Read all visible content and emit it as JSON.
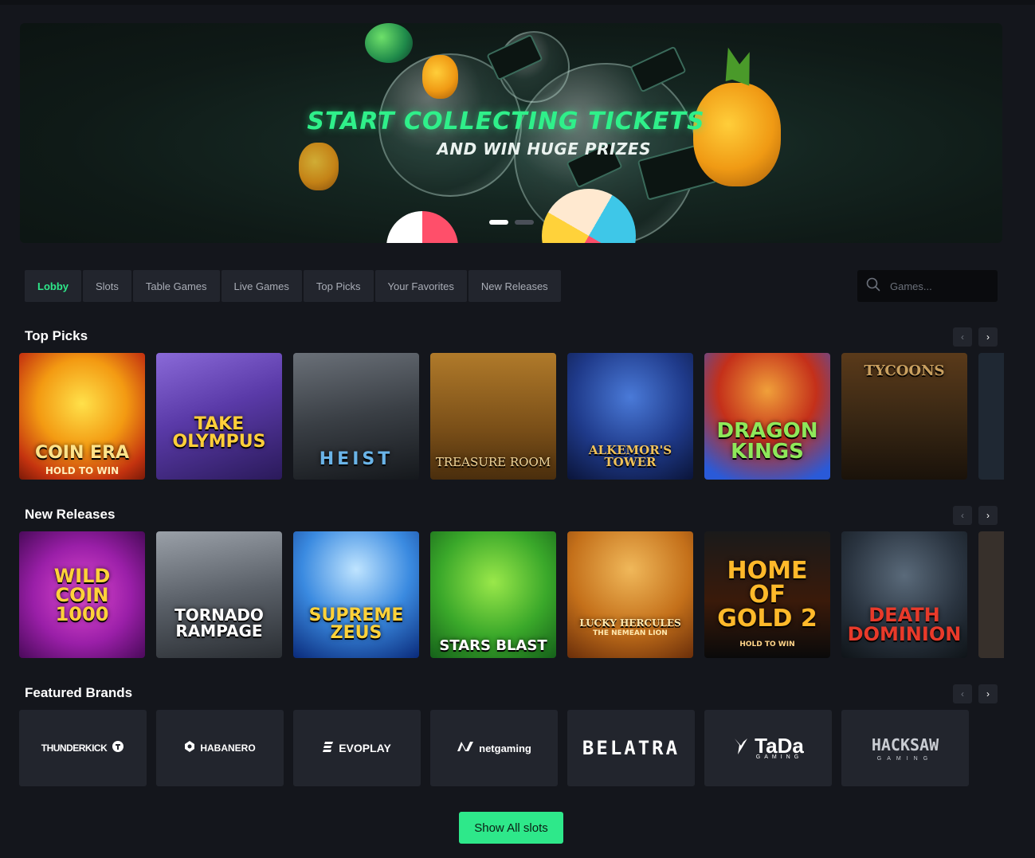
{
  "banner": {
    "title": "START COLLECTING TICKETS",
    "subtitle": "AND WIN HUGE PRIZES",
    "slide_count": 2,
    "active_slide": 1
  },
  "nav": {
    "tabs": [
      {
        "label": "Lobby",
        "active": true
      },
      {
        "label": "Slots",
        "active": false
      },
      {
        "label": "Table Games",
        "active": false
      },
      {
        "label": "Live Games",
        "active": false
      },
      {
        "label": "Top Picks",
        "active": false
      },
      {
        "label": "Your Favorites",
        "active": false
      },
      {
        "label": "New Releases",
        "active": false
      }
    ]
  },
  "search": {
    "placeholder": "Games...",
    "icon": "search-icon"
  },
  "sections": {
    "top_picks": {
      "title": "Top Picks",
      "games": [
        {
          "name": "COIN ERA",
          "sub": "HOLD TO WIN"
        },
        {
          "name": "TAKE OLYMPUS",
          "sub": ""
        },
        {
          "name": "HEIST",
          "sub": ""
        },
        {
          "name": "TREASURE ROOM",
          "sub": ""
        },
        {
          "name": "ALKEMOR'S TOWER",
          "sub": ""
        },
        {
          "name": "DRAGON KINGS",
          "sub": ""
        },
        {
          "name": "TYCOONS",
          "sub": ""
        }
      ]
    },
    "new_releases": {
      "title": "New Releases",
      "games": [
        {
          "name": "WILD COIN 1000",
          "sub": ""
        },
        {
          "name": "TORNADO RAMPAGE",
          "sub": ""
        },
        {
          "name": "SUPREME ZEUS",
          "sub": ""
        },
        {
          "name": "STARS BLAST",
          "sub": ""
        },
        {
          "name": "LUCKY HERCULES",
          "sub": "THE NEMEAN LION"
        },
        {
          "name": "HOME OF GOLD 2",
          "sub": "HOLD TO WIN"
        },
        {
          "name": "DEATH DOMINION",
          "sub": ""
        }
      ]
    },
    "featured_brands": {
      "title": "Featured Brands",
      "brands": [
        {
          "name": "THUNDERKICK"
        },
        {
          "name": "HABANERO"
        },
        {
          "name": "EVOPLAY"
        },
        {
          "name": "netgaming"
        },
        {
          "name": "BELATRA"
        },
        {
          "name": "TaDa",
          "sub": "GAMING"
        },
        {
          "name": "HACKSAW",
          "sub": "GAMING"
        }
      ]
    }
  },
  "arrows": {
    "prev": "‹",
    "next": "›"
  },
  "footer": {
    "show_all_label": "Show All slots"
  },
  "colors": {
    "background": "#14161c",
    "accent": "#2ee88a",
    "tab_bg": "#22252d",
    "tab_text": "#a9adb6"
  }
}
